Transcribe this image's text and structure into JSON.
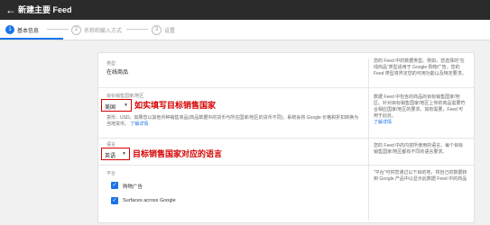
{
  "header": {
    "back_icon": "arrow-left-icon",
    "title": "新建主要 Feed"
  },
  "steps": [
    {
      "number": "1",
      "label": "基本信息",
      "state": "active"
    },
    {
      "number": "2",
      "label": "名称和输入方式",
      "state": "inactive"
    },
    {
      "number": "3",
      "label": "设置",
      "state": "inactive"
    }
  ],
  "form": {
    "type_label": "类型",
    "type_value": "在线商品",
    "country_label": "目标销售国家/地区",
    "country_value": "美国",
    "currency_note": "货币：USD。如果您以其他币种销售商品(商品数据中的货币与所在国家/地区的货币不同)，系统会将 Google 价格和折扣转换为当地货币。",
    "currency_link": "了解详情",
    "language_label": "语言",
    "language_value": "英语",
    "platform_label": "平台",
    "platforms": [
      {
        "label": "购物广告",
        "checked": true
      },
      {
        "label": "Surfaces across Google",
        "checked": true
      }
    ]
  },
  "help": {
    "block1": "您的 Feed 中的数据类型。例如，您选择的“在线商品”类型适用于 Google 购物广告。您的 Feed 类型将界定您的可用功能以及特定要求。",
    "block2": "数据 Feed 中包含的商品的目标销售国家/地区。针对目标销售国家/地区上传的商品需要符合相应国家/地区的要求。如有需要，Feed 可用于此处。",
    "block2_link": "了解详情",
    "block3": "您的 Feed 中的内容所使用的语言。每个目标销售国家/地区都有不同的语言要求。",
    "block4": "“平台”可供您通过以下目的地，将自己的数据转到 Google 产品中以显示此数据 Feed 中的商品"
  },
  "annotations": {
    "country_note": "如实填写目标销售国家",
    "language_note": "目标销售国家对应的语言"
  },
  "colors": {
    "accent": "#1a73e8",
    "annotation": "#d40000",
    "header_bg": "#2b2b2b"
  }
}
